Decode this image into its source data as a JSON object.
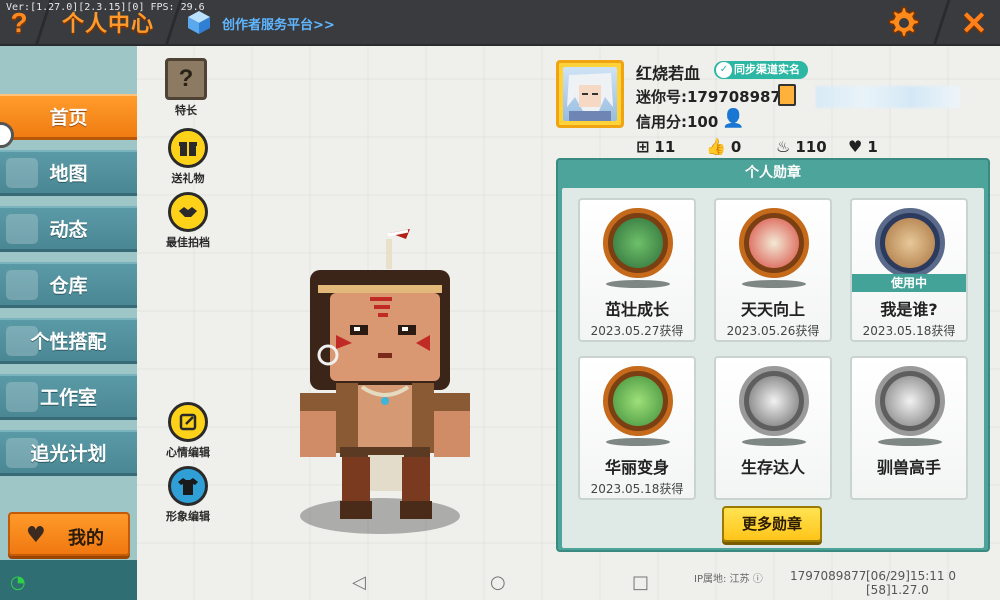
{
  "debug": "Ver:[1.27.0][2.3.15][0] FPS: 29.6",
  "header": {
    "help_glyph": "?",
    "title": "个人中心",
    "creator_link": "创作者服务平台>>",
    "close_glyph": "✕"
  },
  "sidebar": {
    "items": [
      {
        "label": "首页",
        "active": true
      },
      {
        "label": "地图",
        "active": false
      },
      {
        "label": "动态",
        "active": false
      },
      {
        "label": "仓库",
        "active": false
      },
      {
        "label": "个性搭配",
        "active": false
      },
      {
        "label": "工作室",
        "active": false
      },
      {
        "label": "追光计划",
        "active": false
      }
    ],
    "mine_label": "我的"
  },
  "actions": {
    "talent": "特长",
    "talent_glyph": "?",
    "gift": "送礼物",
    "partner": "最佳拍档",
    "mood": "心情编辑",
    "avatar_edit": "形象编辑"
  },
  "profile": {
    "nickname": "红烧若血",
    "verify_badge": "同步渠道实名",
    "mini_id": "迷你号:1797089877",
    "credit": "信用分:100",
    "stats": {
      "plus": "11",
      "likes": "0",
      "fire": "110",
      "hearts": "1"
    }
  },
  "medals": {
    "title": "个人勋章",
    "in_use_label": "使用中",
    "more_button": "更多勋章",
    "items": [
      {
        "name": "茁壮成长",
        "date": "2023.05.27获得",
        "style": "bronze",
        "icon": "plant-medal-icon"
      },
      {
        "name": "天天向上",
        "date": "2023.05.26获得",
        "style": "bronze",
        "icon": "calendar-medal-icon"
      },
      {
        "name": "我是谁?",
        "date": "2023.05.18获得",
        "style": "navy",
        "icon": "id-card-medal-icon",
        "in_use": true
      },
      {
        "name": "华丽变身",
        "date": "2023.05.18获得",
        "style": "bronze",
        "icon": "costume-medal-icon"
      },
      {
        "name": "生存达人",
        "date": "",
        "style": "silver",
        "icon": "flame-medal-icon"
      },
      {
        "name": "驯兽高手",
        "date": "",
        "style": "silver",
        "icon": "horse-medal-icon"
      }
    ]
  },
  "footer": {
    "ip": "IP属地: 江苏",
    "uid": "1797089877",
    "time": "[06/29]15:11 0   [58]1.27.0"
  },
  "colors": {
    "accent": "#f28a1a",
    "teal": "#4da49a",
    "topbar": "#3a3b3f",
    "sidebar": "#4a8794"
  }
}
